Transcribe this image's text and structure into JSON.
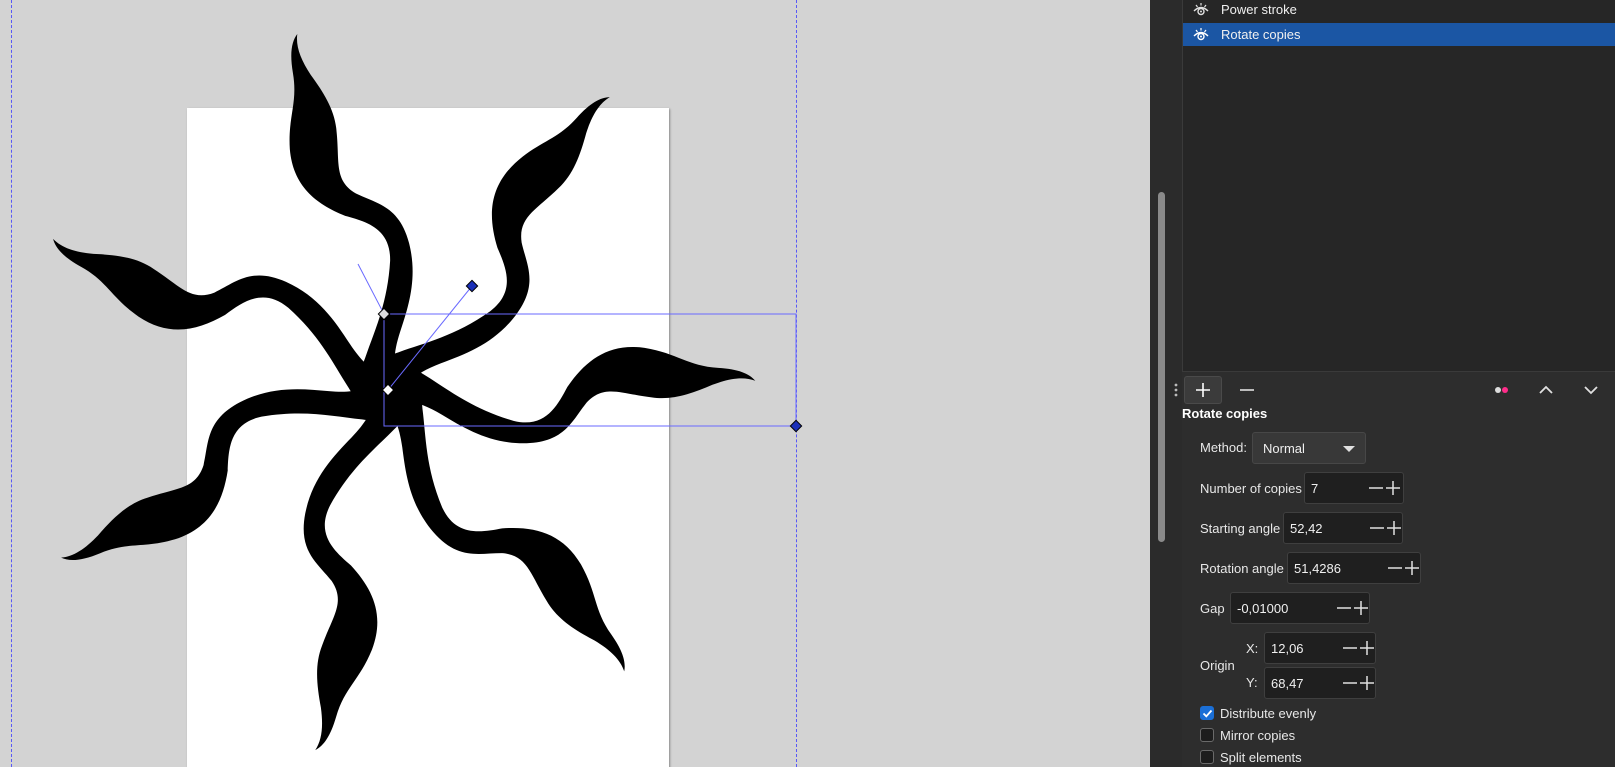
{
  "lpe_list": {
    "items": [
      {
        "label": "Power stroke",
        "selected": false
      },
      {
        "label": "Rotate copies",
        "selected": true
      }
    ]
  },
  "toolbar": {
    "add_icon": "plus-icon",
    "remove_icon": "minus-icon",
    "indicator_icon": "dots-icon",
    "up_icon": "chevron-up-icon",
    "down_icon": "chevron-down-icon"
  },
  "effect": {
    "title": "Rotate copies",
    "method_label": "Method:",
    "method_value": "Normal",
    "copies_label": "Number of copies",
    "copies_value": "7",
    "start_label": "Starting angle",
    "start_value": "52,42",
    "rotation_label": "Rotation angle",
    "rotation_value": "51,4286",
    "gap_label": "Gap",
    "gap_value": "-0,01000",
    "origin_label": "Origin",
    "origin_x_label": "X:",
    "origin_x_value": "12,06",
    "origin_y_label": "Y:",
    "origin_y_value": "68,47",
    "distribute_label": "Distribute evenly",
    "distribute_checked": true,
    "mirror_label": "Mirror copies",
    "mirror_checked": false,
    "split_label": "Split elements",
    "split_checked": false
  },
  "colors": {
    "selection": "#1b56a4",
    "accent": "#1b6fd6",
    "handle": "#1a2fb8",
    "indicator_pink": "#ff2d8a"
  }
}
